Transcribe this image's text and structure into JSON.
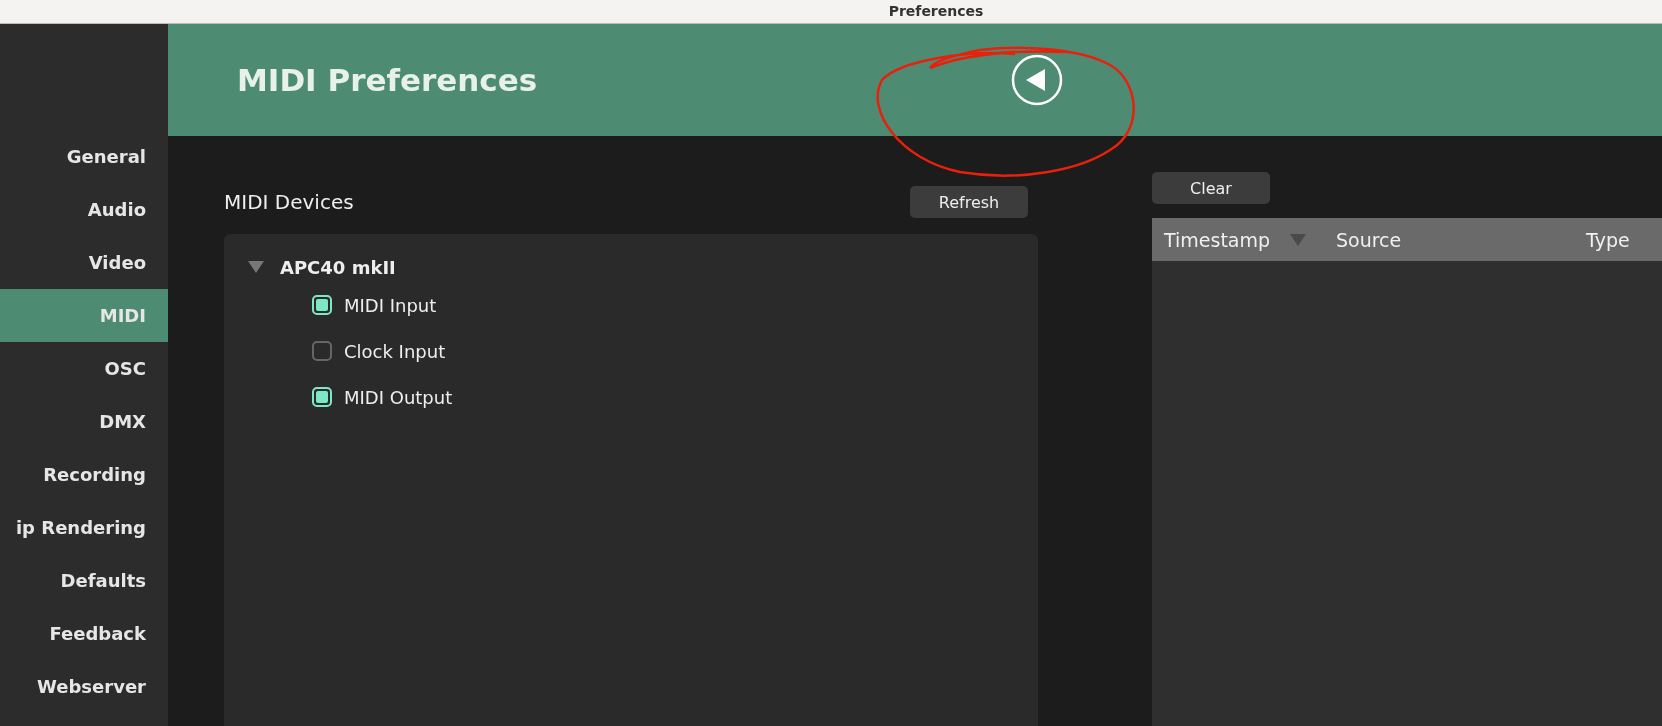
{
  "window": {
    "title": "Preferences"
  },
  "sidebar": {
    "items": [
      {
        "label": "General",
        "selected": false
      },
      {
        "label": "Audio",
        "selected": false
      },
      {
        "label": "Video",
        "selected": false
      },
      {
        "label": "MIDI",
        "selected": true
      },
      {
        "label": "OSC",
        "selected": false
      },
      {
        "label": "DMX",
        "selected": false
      },
      {
        "label": "Recording",
        "selected": false
      },
      {
        "label": "ip Rendering",
        "selected": false
      },
      {
        "label": "Defaults",
        "selected": false
      },
      {
        "label": "Feedback",
        "selected": false
      },
      {
        "label": "Webserver",
        "selected": false
      }
    ]
  },
  "header": {
    "title": "MIDI Preferences"
  },
  "devices": {
    "title": "MIDI Devices",
    "refresh_button": "Refresh",
    "tree": [
      {
        "label": "APC40 mkII",
        "expanded": true,
        "children": [
          {
            "label": "MIDI Input",
            "checked": true
          },
          {
            "label": "Clock Input",
            "checked": false
          },
          {
            "label": "MIDI Output",
            "checked": true
          }
        ]
      }
    ]
  },
  "monitor": {
    "clear_button": "Clear",
    "table": {
      "columns": [
        {
          "label": "Timestamp",
          "sorted": true
        },
        {
          "label": "Source",
          "sorted": false
        },
        {
          "label": "Type",
          "sorted": false
        }
      ]
    }
  }
}
